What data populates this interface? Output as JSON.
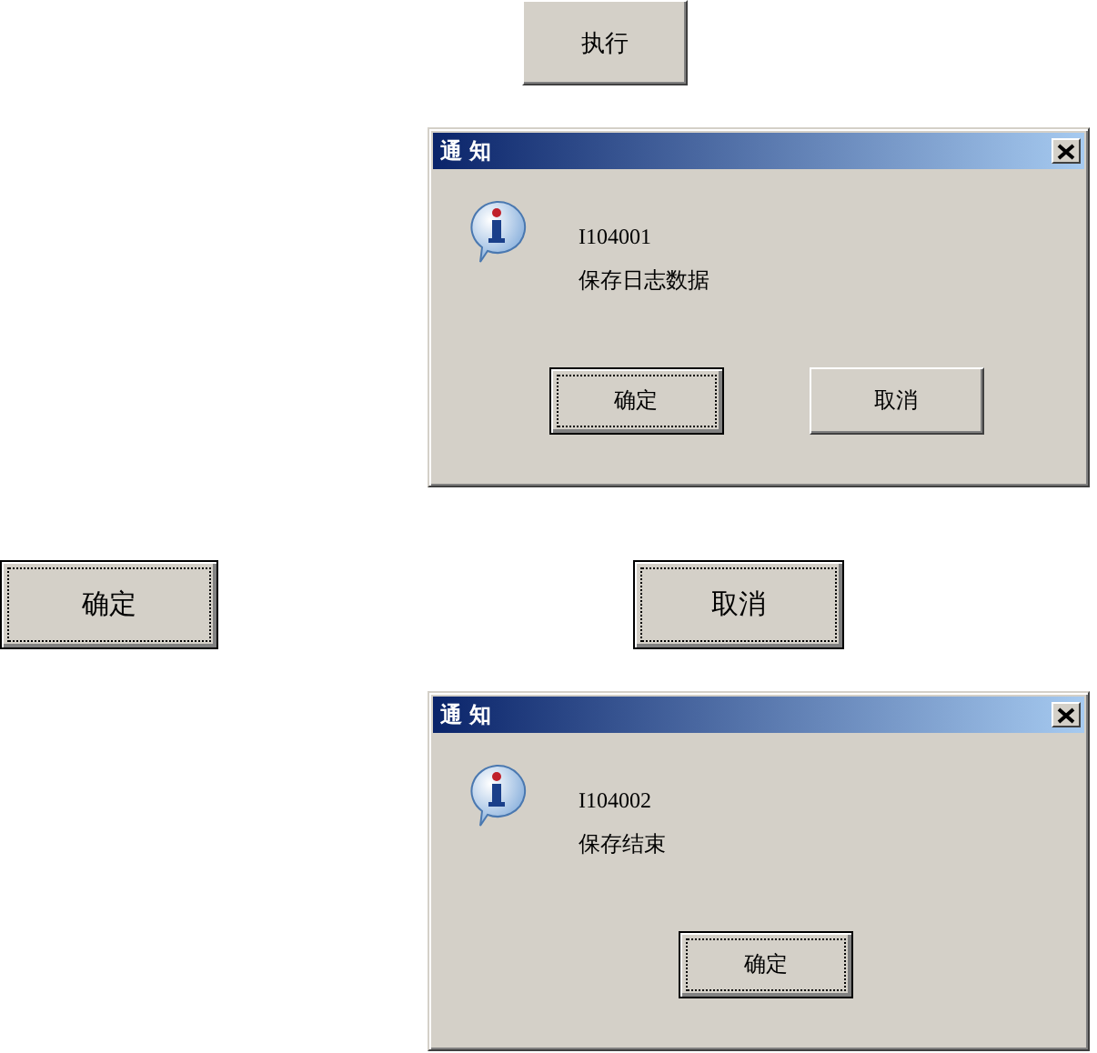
{
  "execute_button": {
    "label": "执行",
    "focused": false
  },
  "first_dialog": {
    "title": "通 知",
    "code": "I104001",
    "message": "保存日志数据",
    "buttons": [
      {
        "label": "确定",
        "focused": true
      },
      {
        "label": "取消",
        "focused": false
      }
    ]
  },
  "button_row": [
    {
      "label": "确定",
      "focused": true
    },
    {
      "label": "取消",
      "focused": true
    }
  ],
  "second_dialog": {
    "title": "通 知",
    "code": "I104002",
    "message": "保存结束",
    "buttons": [
      {
        "label": "确定",
        "focused": true
      }
    ]
  }
}
